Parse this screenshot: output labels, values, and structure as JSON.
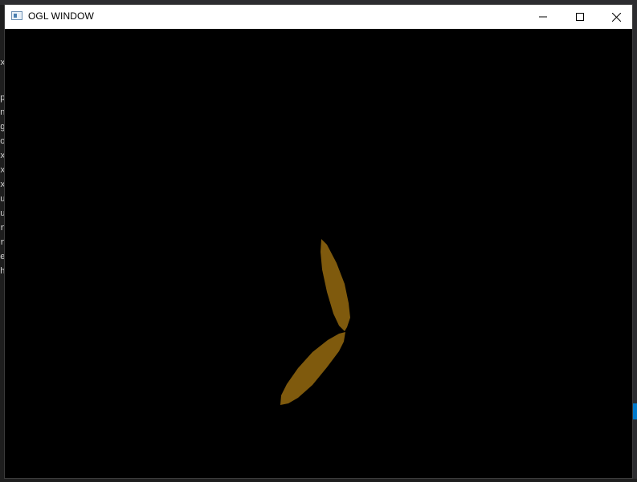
{
  "window": {
    "title": "OGL WINDOW",
    "controls": {
      "minimize_icon": "minimize-icon",
      "maximize_icon": "maximize-icon",
      "close_icon": "close-icon"
    }
  },
  "scene": {
    "background_color": "#000000",
    "petal_color": "#7f5a0d"
  },
  "background_editor": {
    "left_margin_chars": [
      "x",
      "p",
      "n",
      "g",
      "o",
      "x",
      "x",
      "x",
      "u",
      "u",
      "r",
      "r",
      "e",
      "h"
    ]
  }
}
